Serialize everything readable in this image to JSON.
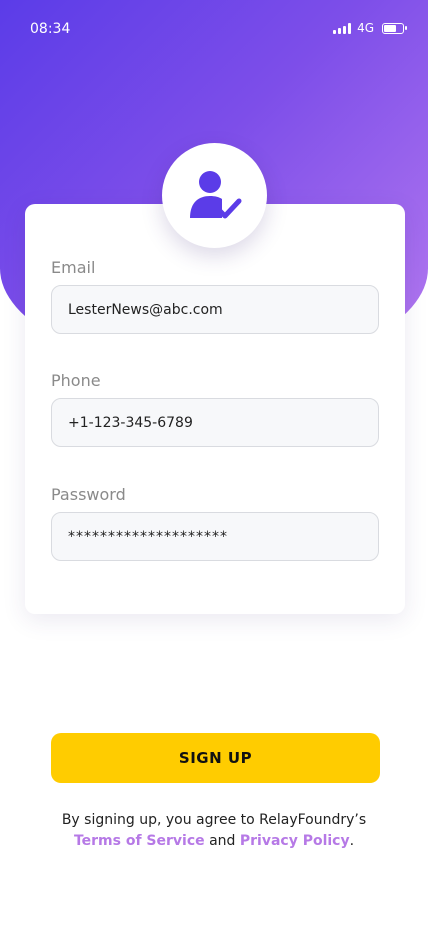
{
  "status_bar": {
    "time": "08:34",
    "network": "4G",
    "signal_icon": "signal-bars-icon",
    "battery_icon": "battery-icon",
    "battery_level": 0.6
  },
  "colors": {
    "gradient_start": "#5b3ce8",
    "gradient_end": "#b57af0",
    "accent": "#5b3ce8",
    "button": "#ffcc00",
    "link": "#b679e6"
  },
  "avatar": {
    "icon": "user-check-icon"
  },
  "form": {
    "email": {
      "label": "Email",
      "value": "LesterNews@abc.com"
    },
    "phone": {
      "label": "Phone",
      "value": "+1-123-345-6789"
    },
    "password": {
      "label": "Password",
      "value": "********************"
    }
  },
  "actions": {
    "signup_label": "SIGN UP"
  },
  "legal": {
    "prefix": "By signing up, you agree to RelayFoundry’s",
    "terms": "Terms of Service",
    "and": "and",
    "privacy": "Privacy Policy",
    "suffix": "."
  }
}
